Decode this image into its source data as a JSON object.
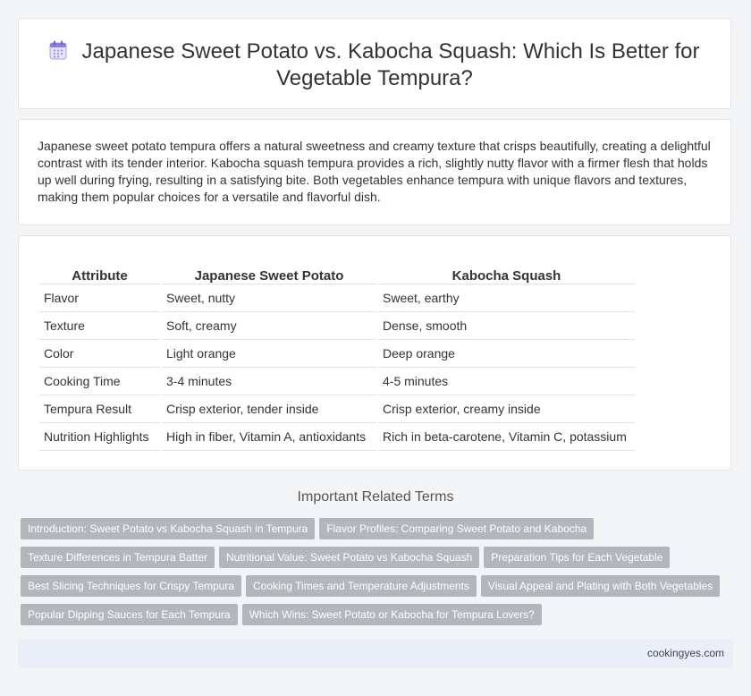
{
  "header": {
    "title": "Japanese Sweet Potato vs. Kabocha Squash: Which Is Better for Vegetable Tempura?",
    "icon": "calendar-icon"
  },
  "intro": {
    "text": "Japanese sweet potato tempura offers a natural sweetness and creamy texture that crisps beautifully, creating a delightful contrast with its tender interior. Kabocha squash tempura provides a rich, slightly nutty flavor with a firmer flesh that holds up well during frying, resulting in a satisfying bite. Both vegetables enhance tempura with unique flavors and textures, making them popular choices for a versatile and flavorful dish."
  },
  "table": {
    "headers": [
      "Attribute",
      "Japanese Sweet Potato",
      "Kabocha Squash"
    ],
    "rows": [
      [
        "Flavor",
        "Sweet, nutty",
        "Sweet, earthy"
      ],
      [
        "Texture",
        "Soft, creamy",
        "Dense, smooth"
      ],
      [
        "Color",
        "Light orange",
        "Deep orange"
      ],
      [
        "Cooking Time",
        "3-4 minutes",
        "4-5 minutes"
      ],
      [
        "Tempura Result",
        "Crisp exterior, tender inside",
        "Crisp exterior, creamy inside"
      ],
      [
        "Nutrition Highlights",
        "High in fiber, Vitamin A, antioxidants",
        "Rich in beta-carotene, Vitamin C, potassium"
      ]
    ]
  },
  "related": {
    "heading": "Important Related Terms",
    "tag_rows": [
      [
        "Introduction: Sweet Potato vs Kabocha Squash in Tempura",
        "Flavor Profiles: Comparing Sweet Potato and Kabocha"
      ],
      [
        "Texture Differences in Tempura Batter",
        "Nutritional Value: Sweet Potato vs Kabocha Squash",
        "Preparation Tips for Each Vegetable"
      ],
      [
        "Best Slicing Techniques for Crispy Tempura",
        "Cooking Times and Temperature Adjustments",
        "Visual Appeal and Plating with Both Vegetables"
      ],
      [
        "Popular Dipping Sauces for Each Tempura",
        "Which Wins: Sweet Potato or Kabocha for Tempura Lovers?"
      ]
    ]
  },
  "footer": {
    "site": "cookingyes.com"
  },
  "colors": {
    "page_bg": "#f3f4f6",
    "tag_bg": "#b3b7bd",
    "footer_bg": "#e9eef8",
    "icon_accent": "#8a7fe0"
  }
}
